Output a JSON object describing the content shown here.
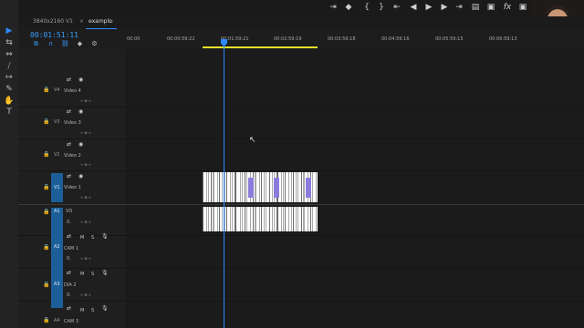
{
  "tabs": [
    {
      "label": "3840x2160 V1"
    },
    {
      "label": "example"
    }
  ],
  "tab_close_glyph": "≡",
  "tab_close_x": "×",
  "timecode": "00:01:51:11",
  "ruler": {
    "labels": [
      "00:00",
      "00:00:59:22",
      "00:01:59:21",
      "00:02:59:19",
      "00:03:59:18",
      "00:04:59:16",
      "00:05:59:15",
      "00:06:59:13"
    ]
  },
  "toolbar_icons": [
    "export-icon",
    "marker-icon",
    "brace-open-icon",
    "brace-close-icon",
    "go-in-icon",
    "step-back-icon",
    "play-icon",
    "step-forward-icon",
    "go-out-icon",
    "insert-icon",
    "overwrite-icon",
    "fx-icon",
    "camera-icon"
  ],
  "toolbar_glyphs": [
    "⇥",
    "◆",
    "{",
    "}",
    "⇤",
    "◀",
    "▶",
    "▶",
    "⇥",
    "▤",
    "▣",
    "fx",
    "▣"
  ],
  "tool_glyphs": [
    "▶",
    "⇆",
    "⇔",
    "⧸",
    "↦",
    "✎",
    "✋",
    "T"
  ],
  "video_tracks": [
    {
      "id": "V4",
      "name": "Video 4"
    },
    {
      "id": "V3",
      "name": "Video 3"
    },
    {
      "id": "V2",
      "name": "Video 2"
    },
    {
      "id": "V1",
      "name": "Video 1"
    }
  ],
  "audio_tracks": [
    {
      "id": "A1",
      "name": "VO"
    },
    {
      "id": "A2",
      "name": "CAM 1"
    },
    {
      "id": "A3",
      "name": "DIA 2"
    },
    {
      "id": "A4",
      "name": "CAM 3"
    }
  ],
  "source_target": "V1",
  "audio_buttons": {
    "mute": "M",
    "solo": "S"
  },
  "audio_volume_value": "0.",
  "colors": {
    "accent": "#2e8bff",
    "work_area": "#e8e32a",
    "target_blue": "#1c5f98"
  }
}
